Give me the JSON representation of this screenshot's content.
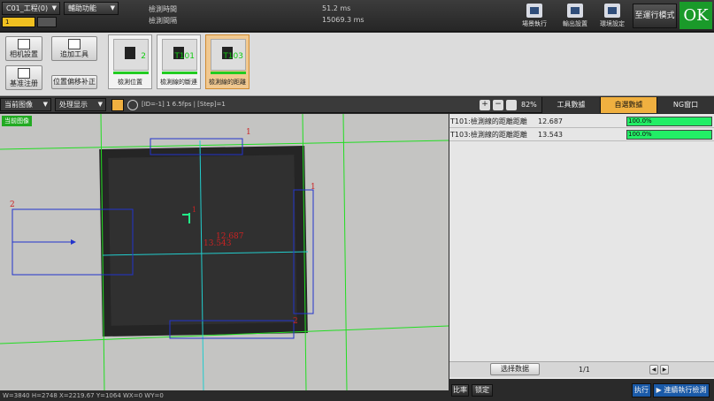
{
  "topbar": {
    "scene_select": "C01_工程(0)",
    "help_menu": "輔助功能",
    "page_indicator": "1",
    "time_labels": [
      "檢測時間",
      "檢測間隔"
    ],
    "time_values": [
      "51.2 ms",
      "15069.3 ms"
    ],
    "buttons": [
      {
        "label": "場景執行",
        "icon": "scene-run-icon"
      },
      {
        "label": "輸出設置",
        "icon": "output-settings-icon"
      },
      {
        "label": "環境設定",
        "icon": "environment-settings-icon"
      }
    ],
    "run_mode_label": "至運行模式",
    "ok_label": "OK",
    "ok_color": "#1a9a2a"
  },
  "toolstrip": {
    "left_buttons": [
      "相机設置",
      "基准注册"
    ],
    "mid_buttons": [
      "追加工具",
      "位置偏移补正"
    ],
    "steps": [
      {
        "label": "檢測位置",
        "num": "2"
      },
      {
        "label": "檢測線的斷連",
        "num": "T101"
      },
      {
        "label": "檢測線的距離",
        "num": "T103"
      }
    ]
  },
  "imgbar": {
    "image_select": "当前图像",
    "display_select": "处理显示",
    "info": "[ID=-1] 1 6.5fps | [Step]=1",
    "zoom_level": "82%",
    "tabs": [
      "工具數據",
      "自選數據",
      "NG窗口"
    ],
    "selected_tab": 1
  },
  "image": {
    "badge": "当前图像",
    "value_a": "12.687",
    "value_b": "13.543",
    "marks": [
      "1",
      "2",
      "1",
      "2",
      "1"
    ]
  },
  "coords": "W=3840  H=2748  X=2219.67  Y=1064  WX=0  WY=0",
  "results": [
    {
      "name": "T101:檢測線的距離距離",
      "value": "12.687",
      "percent": "100.0%"
    },
    {
      "name": "T103:檢測線的距離距離",
      "value": "13.543",
      "percent": "100.0%"
    }
  ],
  "rpanel": {
    "select_data_button": "选择数据",
    "page": "1/1",
    "compare_button": "比率",
    "fix_button": "锁定",
    "execute_button": "执行",
    "run_detect_button": "連續執行檢測"
  }
}
